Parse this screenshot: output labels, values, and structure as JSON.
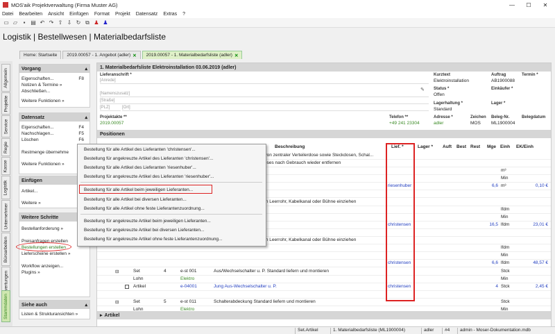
{
  "window": {
    "title": "MOS'aik Projektverwaltung (Firma Muster AG)",
    "min": "—",
    "max": "☐",
    "close": "✕"
  },
  "menu": [
    "Datei",
    "Bearbeiten",
    "Ansicht",
    "Einfügen",
    "Format",
    "Projekt",
    "Datensatz",
    "Extras",
    "?"
  ],
  "toolbar_icons": [
    "new-icon",
    "open-icon",
    "save-icon",
    "print-icon",
    "undo-icon",
    "redo-icon",
    "up-icon",
    "down-icon",
    "refresh-icon",
    "copy-icon",
    "user-icon",
    "user-alt-icon"
  ],
  "breadcrumb": "Logistik | Bestellwesen | Materialbedarfsliste",
  "tabs": [
    {
      "label": "Home: Startseite"
    },
    {
      "label": "2019.00057 - 1. Angebot (adler)",
      "close": "✕"
    },
    {
      "label": "2019.00057 - 1. Materialbedarfsliste (adler)",
      "close": "✕"
    }
  ],
  "vtabs": [
    "Allgemein",
    "Projekte",
    "Service",
    "Regie",
    "Kasse",
    "Logistik",
    "Unternehmer",
    "Büroarbeiten",
    "Auswertungen",
    "Stammdaten"
  ],
  "sidebar": {
    "vorgang": {
      "title": "Vorgang",
      "items": [
        {
          "label": "Eigenschaften...",
          "key": "F8"
        },
        {
          "label": "Notizen & Termine »",
          "key": ""
        },
        {
          "label": "Abschließen...",
          "key": ""
        }
      ],
      "more": "Weitere Funktionen »"
    },
    "datensatz": {
      "title": "Datensatz",
      "items": [
        {
          "label": "Eigenschaften...",
          "key": "F4"
        },
        {
          "label": "Nachschlagen...",
          "key": "F5"
        },
        {
          "label": "Löschen",
          "key": "F6"
        }
      ],
      "rest": "Restmenge übernehme",
      "more": "Weitere Funktionen »"
    },
    "einfuegen": {
      "title": "Einfügen",
      "items": [
        "Artikel...",
        "Weitere »"
      ]
    },
    "schritte": {
      "title": "Weitere Schritte",
      "items": [
        "Bestellanforderung »",
        "Preisanfragen erstellen",
        "Bestellungen erstellen",
        "Lieferscheine erstellen »",
        "Workflow anzeigen...",
        "Plugins »"
      ]
    },
    "siehe": {
      "title": "Siehe auch",
      "items": [
        "Listen & Strukturansichten »"
      ]
    }
  },
  "header": {
    "title": "1. Materialbedarfsliste Elektroinstallation 03.06.2019 (adler)",
    "anschrift_label": "Lieferanschrift *",
    "anrede": "[Anrede]",
    "namenszusatz": "[Namenszusatz]",
    "strasse": "[Straße]",
    "plz": "[PLZ]",
    "ort": "[Ort]",
    "kurztext_label": "Kurztext",
    "kurztext": "Elektroinstallation",
    "auftrag_label": "Auftrag",
    "auftrag": "AB1900088",
    "termin_label": "Termin *",
    "status_label": "Status *",
    "status": "Offen",
    "einkaeufer_label": "Einkäufer *",
    "lagerhaltung_label": "Lagerhaltung *",
    "lagerhaltung": "Standard",
    "lager_label": "Lager *",
    "projektakte_label": "Projektakte **",
    "projektakte": "2019.00057",
    "telefon_label": "Telefon **",
    "telefon": "+49 241 23304",
    "adresse_label": "Adresse *",
    "adresse": "adler",
    "zeichen_label": "Zeichen",
    "zeichen": "MOS",
    "belegnr_label": "Beleg-Nr.",
    "belegnr": "ML1900004",
    "belegdatum_label": "Belegdatum"
  },
  "positions": {
    "title": "Positionen",
    "columns": [
      "Beschreibung",
      "Lief. *",
      "Lager *",
      "Auft",
      "Best",
      "Rest",
      "Mge",
      "Einh",
      "EK/Einh"
    ],
    "rows": [
      {
        "desc": "d von zentraler Verteilerdose sowie Steckdosen, Schal...",
        "lief": "",
        "mge": "",
        "einh": "",
        "ek": ""
      },
      {
        "desc": "dieses nach Gebrauch wieder entfernen",
        "lief": "",
        "mge": "",
        "einh": "",
        "ek": ""
      },
      {
        "desc": "",
        "lief": "",
        "mge": "",
        "einh": "m³",
        "ek": ""
      },
      {
        "desc": "",
        "lief": "",
        "mge": "",
        "einh": "Min",
        "ek": ""
      },
      {
        "desc": "",
        "lief": "riesenhuber",
        "mge": "6,6",
        "einh": "m³",
        "ek": "0,10 €"
      },
      {
        "desc": "",
        "lief": "",
        "mge": "",
        "einh": "",
        "ek": ""
      },
      {
        "desc": "5 in Leerrohr, Kabelkanal oder Bühne einziehen",
        "lief": "",
        "mge": "",
        "einh": "",
        "ek": ""
      },
      {
        "desc": "",
        "lief": "",
        "mge": "",
        "einh": "lfdm",
        "ek": ""
      },
      {
        "desc": "",
        "lief": "",
        "mge": "",
        "einh": "Min",
        "ek": ""
      },
      {
        "desc": "",
        "lief": "christensen",
        "mge": "16,5",
        "einh": "lfdm",
        "ek": "23,01 €"
      },
      {
        "desc": "",
        "lief": "",
        "mge": "",
        "einh": "",
        "ek": ""
      },
      {
        "desc": "5 in Leerrohr, Kabelkanal oder Bühne einziehen",
        "lief": "",
        "mge": "",
        "einh": "",
        "ek": ""
      },
      {
        "desc": "",
        "lief": "",
        "mge": "",
        "einh": "lfdm",
        "ek": ""
      },
      {
        "desc": "",
        "lief": "",
        "mge": "",
        "einh": "Min",
        "ek": ""
      },
      {
        "desc": "",
        "lief": "christensen",
        "mge": "6,6",
        "einh": "lfdm",
        "ek": "48,57 €"
      }
    ],
    "set_rows": [
      {
        "type": "Set",
        "pos": "4",
        "nr": "e-st 001",
        "desc": "Aus/Wechselschalter u. P. Standard liefern und montieren",
        "lief": "",
        "mge": "",
        "einh": "Stck",
        "ek": ""
      },
      {
        "type": "Lohn",
        "pos": "",
        "nr": "Elektro",
        "desc": "",
        "lief": "",
        "mge": "",
        "einh": "Min",
        "ek": ""
      },
      {
        "type": "Artikel",
        "pos": "",
        "nr": "e-04001",
        "desc": "Jung Aus-Wechselschalter u. P.",
        "lief": "christensen",
        "mge": "4",
        "einh": "Stck",
        "ek": "2,45 €"
      },
      {
        "type": "",
        "pos": "",
        "nr": "",
        "desc": "",
        "lief": "",
        "mge": "",
        "einh": "",
        "ek": ""
      },
      {
        "type": "Set",
        "pos": "5",
        "nr": "e-st 011",
        "desc": "Schalterabdeckung Standard liefern und montieren",
        "lief": "",
        "mge": "",
        "einh": "Stck",
        "ek": ""
      },
      {
        "type": "Lohn",
        "pos": "",
        "nr": "Elektro",
        "desc": "",
        "lief": "",
        "mge": "",
        "einh": "Min",
        "ek": ""
      }
    ]
  },
  "artikel_title": "Artikel",
  "context_menu": [
    "Bestellung für alle Artikel des Lieferanten 'christensen'...",
    "Bestellung für angekreuzte Artikel des Lieferanten 'christensen'...",
    "Bestellung für alle Artikel des Lieferanten 'riesenhuber'...",
    "Bestellung für angekreuzte Artikel des Lieferanten 'riesenhuber'...",
    "Bestellung für alle Artikel beim jeweiligen Lieferanten...",
    "Bestellung für alle Artikel bei diversen Lieferanten...",
    "Bestellung für alle Artikel ohne feste Lieferantenzuordnung...",
    "Bestellung für angekreuzte Artikel beim jeweiligen Lieferanten...",
    "Bestellung für angekreuzte Artikel bei diversen Lieferanten...",
    "Bestellung für angekreuzte Artikel ohne feste Lieferantenzuordnung..."
  ],
  "status": [
    "Set.Artikel",
    "1. Materialbedarfsliste (ML1900004)",
    "adler",
    "#4",
    "admin - Moser-Dokumentation.mdb"
  ],
  "colors": {
    "green": "#3a8a24",
    "blue": "#2440c0",
    "highlight": "#dd2222"
  }
}
